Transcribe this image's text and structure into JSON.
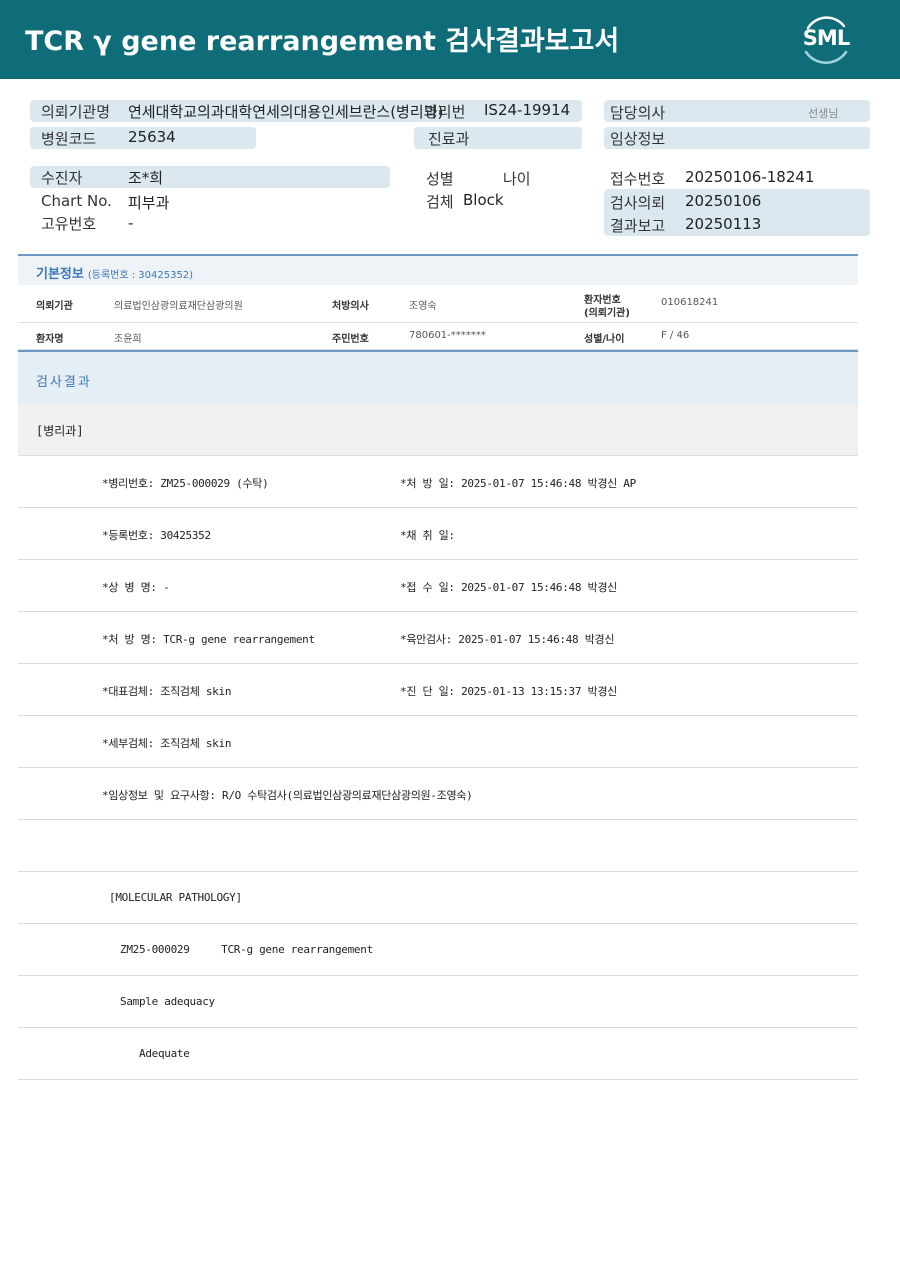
{
  "header": {
    "title": "TCR γ gene rearrangement 검사결과보고서",
    "logo_text": "SML",
    "colors": {
      "header_bg": "#0e6d78",
      "accent_blue": "#3a78b8",
      "pill_bg": "#dbe8ef"
    }
  },
  "top_info": {
    "requesting_institution_label": "의뢰기관명",
    "requesting_institution_value": "연세대학교의과대학연세의대용인세브란스(병리과)",
    "registration_label": "병리번",
    "registration_value": "IS24-19914",
    "attending_doctor_label": "담당의사",
    "attending_doctor_suffix": "선생님",
    "hospital_code_label": "병원코드",
    "hospital_code_value": "25634",
    "department_label": "진료과",
    "clinical_info_label": "임상정보",
    "patient_label": "수진자",
    "patient_value": "조*희",
    "sex_label": "성별",
    "age_label": "나이",
    "receipt_no_label": "접수번호",
    "receipt_no_value": "20250106-18241",
    "chart_no_label": "Chart No.",
    "chart_no_value": "피부과",
    "specimen_label": "검체",
    "specimen_value": "Block",
    "test_request_label": "검사의뢰",
    "test_request_value": "20250106",
    "unique_no_label": "고유번호",
    "unique_no_value": "-",
    "result_report_label": "결과보고",
    "result_report_value": "20250113"
  },
  "basic_info": {
    "title": "기본정보",
    "subtitle": "(등록번호 : 30425352)",
    "rows": [
      {
        "k1": "의뢰기관",
        "v1": "의료법인삼광의료재단삼광의원",
        "k2": "처방의사",
        "v2": "조영숙",
        "k3a": "환자번호",
        "k3b": "(의뢰기관)",
        "v3": "010618241"
      },
      {
        "k1": "환자명",
        "v1": "조윤희",
        "k2": "주민번호",
        "v2": "780601-*******",
        "k3a": "성별/나이",
        "k3b": "",
        "v3": "F / 46"
      }
    ]
  },
  "results": {
    "title": "검사결과",
    "department": "[병리과]",
    "lines": [
      {
        "left": "*병리번호: ZM25-000029 (수탁)",
        "right": "*처 방 일: 2025-01-07 15:46:48  박경신 AP"
      },
      {
        "left": "*등록번호: 30425352",
        "right": "*채 취 일:"
      },
      {
        "left": "*상 병 명: -",
        "right": "*접 수 일: 2025-01-07 15:46:48  박경신"
      },
      {
        "left": "*처 방 명: TCR-g gene rearrangement",
        "right": "*육안검사: 2025-01-07 15:46:48  박경신"
      },
      {
        "left": "*대표검체: 조직검체 skin",
        "right": "*진 단 일: 2025-01-13 13:15:37  박경신"
      },
      {
        "left": "*세부검체: 조직검체 skin",
        "right": ""
      },
      {
        "left": "*임상정보 및 요구사항: R/O 수탁검사(의료법인삼광의료재단삼광의원-조영숙)",
        "right": ""
      },
      {
        "left": "",
        "right": ""
      }
    ],
    "molecular": [
      {
        "text": "[MOLECULAR PATHOLOGY]",
        "indent": 1
      },
      {
        "text": "ZM25-000029     TCR-g gene rearrangement",
        "indent": 2
      },
      {
        "text": "Sample adequacy",
        "indent": 2
      },
      {
        "text": "Adequate",
        "indent": 3
      }
    ]
  }
}
